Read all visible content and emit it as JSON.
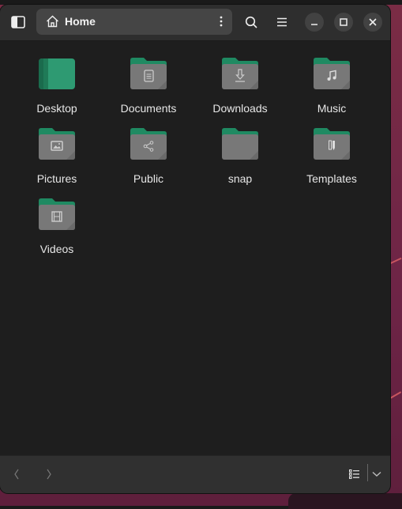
{
  "header": {
    "sidebar_toggle_icon": "sidebar-icon",
    "path": {
      "title": "Home",
      "icon": "home-icon",
      "menu_icon": "vertical-dots-icon"
    },
    "search_icon": "search-icon",
    "menu_icon": "hamburger-icon",
    "minimize_icon": "minimize-icon",
    "maximize_icon": "maximize-icon",
    "close_icon": "close-icon"
  },
  "items": [
    {
      "label": "Desktop",
      "icon": "desktop-folder"
    },
    {
      "label": "Documents",
      "icon": "document"
    },
    {
      "label": "Downloads",
      "icon": "download"
    },
    {
      "label": "Music",
      "icon": "music"
    },
    {
      "label": "Pictures",
      "icon": "picture"
    },
    {
      "label": "Public",
      "icon": "share"
    },
    {
      "label": "snap",
      "icon": "none"
    },
    {
      "label": "Templates",
      "icon": "template"
    },
    {
      "label": "Videos",
      "icon": "film"
    }
  ],
  "footer": {
    "back_icon": "chevron-left-icon",
    "forward_icon": "chevron-right-icon",
    "view_icon": "list-view-icon",
    "view_menu_icon": "chevron-down-icon"
  },
  "colors": {
    "folder_top": "#1f8a62",
    "folder_body": "#787878",
    "desktop": "#2e9a72"
  }
}
